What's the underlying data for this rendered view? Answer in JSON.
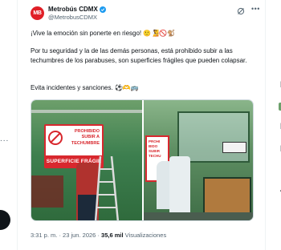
{
  "tweet": {
    "author_name": "Metrobús CDMX",
    "author_handle": "@MetrobusCDMX",
    "avatar_text": "MB",
    "line1": "¡Vive la emoción sin ponerte en riesgo! 🙂🧏🚫🐒",
    "line2": "Por tu seguridad y la de las demás personas, está prohibido subir a las techumbres de los parabuses, son superficies frágiles que pueden colapsar.",
    "line3": "Evita incidentes y sanciones. ⚽🫶🚌",
    "time": "3:31 p. m.",
    "separator": "·",
    "date": "23 jun. 2026",
    "views_count": "35,6 mil",
    "views_label": "Visualizaciones"
  },
  "media": {
    "sign_line1": "PROHIBIDO",
    "sign_line2": "SUBIR A",
    "sign_line3": "TECHUMBRE",
    "sign_bottom": "SUPERFICIE FRÁGIL",
    "sign2_lines": [
      "PROHI",
      "BIDO",
      "SUBIR",
      "TECHU"
    ]
  },
  "left_rail": {
    "dots": "..."
  },
  "right_rail": {
    "letters": [
      "N",
      "I",
      "I",
      "T"
    ]
  },
  "colors": {
    "accent": "#1d9bf0",
    "brand": "#e01f27",
    "text": "#0f1419",
    "muted": "#536471",
    "sign_red": "#d8282e"
  },
  "icons": [
    "verified-icon",
    "grok-icon",
    "more-options-icon"
  ]
}
